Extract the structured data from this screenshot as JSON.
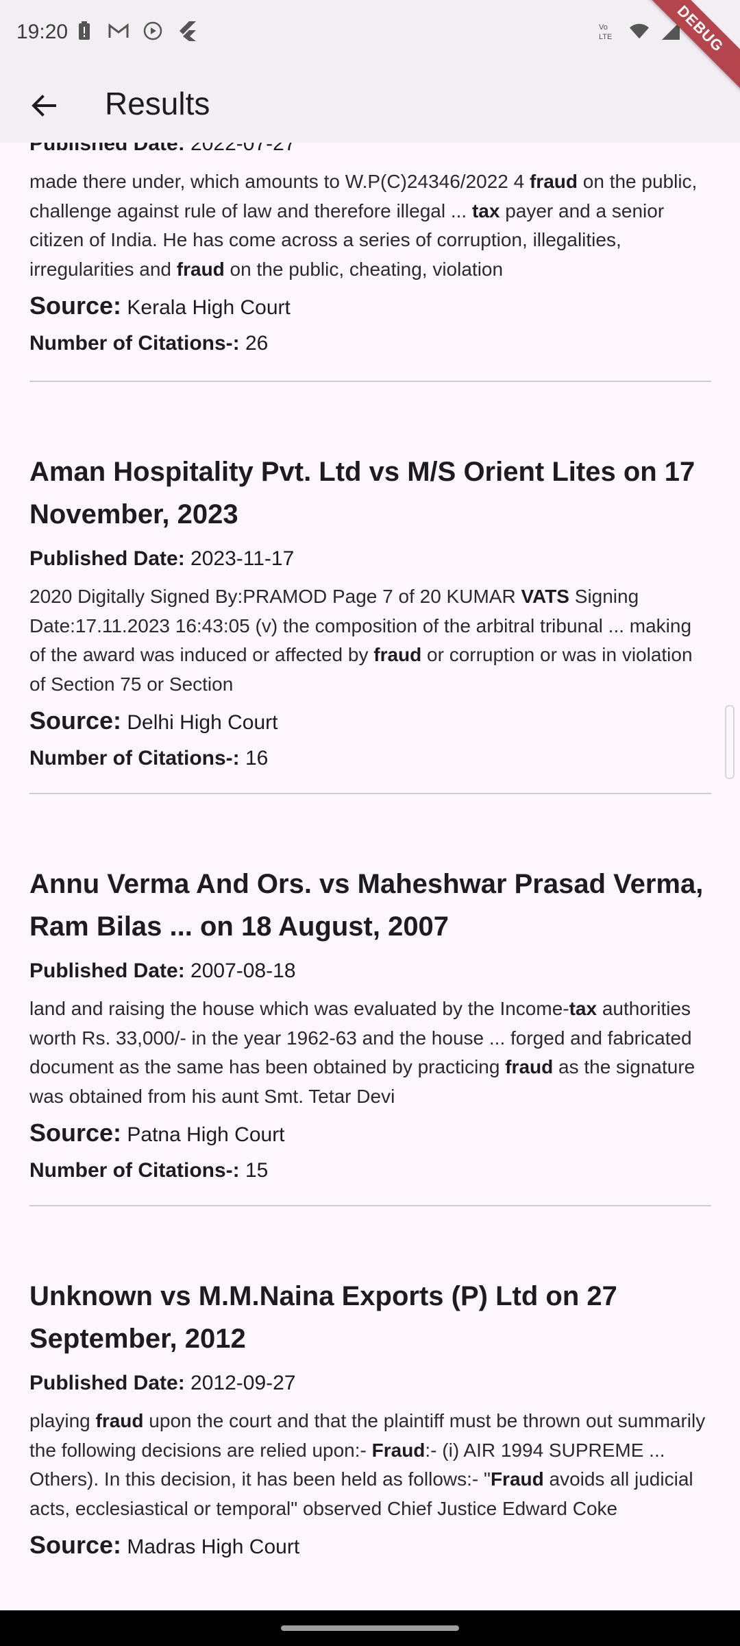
{
  "status": {
    "time": "19:20"
  },
  "debug_label": "DEBUG",
  "app_bar": {
    "title": "Results"
  },
  "labels": {
    "published": "Published Date:",
    "source": "Source:",
    "citations": "Number of Citations-:"
  },
  "results": [
    {
      "title": "",
      "published": "2022-07-27",
      "snippet": "made there under, which amounts to W.P(C)24346/2022 4 <b>fraud</b> on the public, challenge against rule of law and therefore illegal ... <b>tax</b> payer and a senior citizen of India. He has come across a series of corruption, illegalities, irregularities and <b>fraud</b> on the public, cheating, violation",
      "source": "Kerala High Court",
      "citations": "26"
    },
    {
      "title": "Aman Hospitality Pvt. Ltd vs M/S Orient Lites on 17 November, 2023",
      "published": "2023-11-17",
      "snippet": "2020 Digitally Signed By:PRAMOD Page 7 of 20 KUMAR <b>VATS</b> Signing Date:17.11.2023 16:43:05 (v) the composition of the arbitral tribunal ... making of the award was induced or affected by <b>fraud</b> or corruption or was in violation of Section 75 or Section",
      "source": "Delhi High Court",
      "citations": "16"
    },
    {
      "title": "Annu Verma And Ors. vs Maheshwar Prasad Verma, Ram Bilas ... on 18 August, 2007",
      "published": "2007-08-18",
      "snippet": "land and raising the house which was evaluated by the Income-<b>tax</b> authorities worth Rs. 33,000/- in the year 1962-63 and the house ... forged and fabricated document as the same has been obtained by practicing <b>fraud</b> as the signature was obtained from his aunt Smt. Tetar Devi",
      "source": "Patna High Court",
      "citations": "15"
    },
    {
      "title": "Unknown vs M.M.Naina Exports (P) Ltd on 27 September, 2012",
      "published": "2012-09-27",
      "snippet": "playing <b>fraud</b> upon the court and that the plaintiff must be thrown out summarily the following decisions are relied upon:- <b>Fraud</b>:- (i) AIR 1994 SUPREME ... Others). In this decision, it has been held as follows:- \"<b>Fraud</b> avoids all judicial acts, ecclesiastical or temporal\" observed Chief Justice Edward Coke",
      "source": "Madras High Court",
      "citations": ""
    }
  ],
  "colors": {
    "app_bar": "#f3edf4",
    "background": "#fdf7fd",
    "debug": "#b5454c"
  }
}
